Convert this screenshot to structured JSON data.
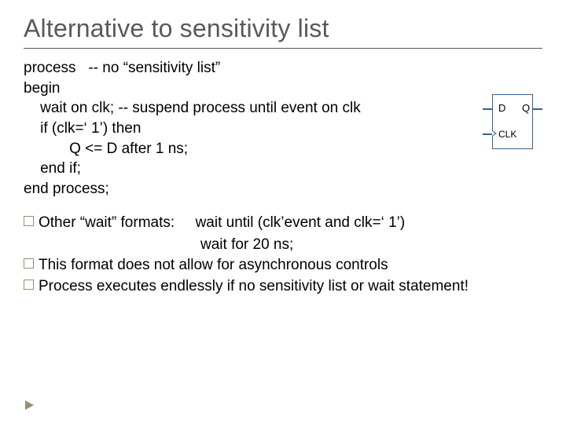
{
  "title": "Alternative to sensitivity list",
  "code": {
    "l1": "process   -- no “sensitivity list”",
    "l2": "begin",
    "l3": "    wait on clk; -- suspend process until event on clk",
    "l4": "    if (clk=‘ 1’) then",
    "l5": "           Q <= D after 1 ns;",
    "l6": "    end if;",
    "l7": "end process;"
  },
  "bullets": {
    "b1_lead": "Other “wait” formats:",
    "b1_wait1": "wait until (clk’event and clk=‘ 1’)",
    "b1_wait2": "wait for 20 ns;",
    "b2": "This format does not allow for asynchronous controls",
    "b3": "Process executes endlessly if no sensitivity list or wait statement!"
  },
  "diagram": {
    "d": "D",
    "q": "Q",
    "clk": "CLK"
  }
}
